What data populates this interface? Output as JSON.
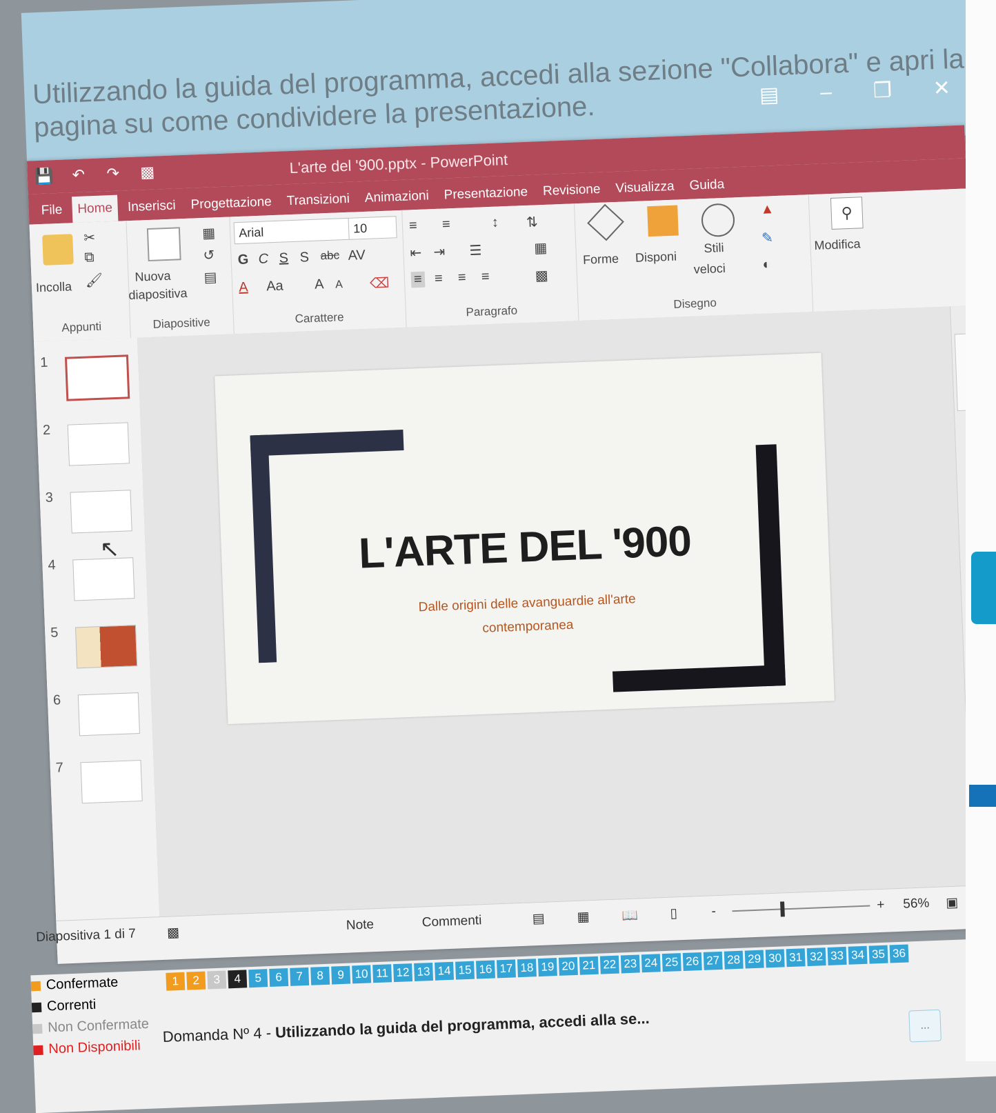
{
  "instruction": "Utilizzando la guida del programma, accedi alla sezione \"Collabora\" e apri la pagina su come condividere la presentazione.",
  "window": {
    "title": "L'arte del '900.pptx - PowerPoint",
    "tabs": [
      "File",
      "Home",
      "Inserisci",
      "Progettazione",
      "Transizioni",
      "Animazioni",
      "Presentazione",
      "Revisione",
      "Visualizza",
      "Guida"
    ],
    "active_tab": "Home"
  },
  "ribbon": {
    "clipboard": {
      "paste_label": "Incolla",
      "group_label": "Appunti"
    },
    "slides": {
      "new_slide_label_1": "Nuova",
      "new_slide_label_2": "diapositiva",
      "group_label": "Diapositive"
    },
    "font": {
      "font_name": "Arial",
      "font_size": "10",
      "bold": "G",
      "italic": "C",
      "underline": "S",
      "shadow": "S",
      "strike": "abc",
      "spacing": "AV",
      "color": "A",
      "case": "Aa",
      "grow": "A",
      "shrink": "A",
      "group_label": "Carattere"
    },
    "paragraph": {
      "group_label": "Paragrafo"
    },
    "drawing": {
      "shapes_label": "Forme",
      "arrange_label": "Disponi",
      "quick_styles_1": "Stili",
      "quick_styles_2": "veloci",
      "group_label": "Disegno"
    },
    "editing": {
      "label": "Modifica"
    }
  },
  "slides": [
    {
      "number": "1",
      "selected": true
    },
    {
      "number": "2"
    },
    {
      "number": "3"
    },
    {
      "number": "4"
    },
    {
      "number": "5"
    },
    {
      "number": "6"
    },
    {
      "number": "7"
    }
  ],
  "slide": {
    "title": "L'ARTE DEL '900",
    "subtitle": "Dalle origini delle avanguardie all'arte contemporanea"
  },
  "status": {
    "slide_counter": "Diapositiva 1 di 7",
    "notes": "Note",
    "comments": "Commenti",
    "zoom": "56%",
    "zoom_minus": "-",
    "zoom_plus": "+"
  },
  "footer": {
    "legend": [
      {
        "label": "Confermate",
        "color": "#f29c1f"
      },
      {
        "label": "Correnti",
        "color": "#222222"
      },
      {
        "label": "Non Confermate",
        "color": "#c8c8c8"
      },
      {
        "label": "Non Disponibili",
        "color": "#e02020"
      }
    ],
    "questions": [
      "1",
      "2",
      "3",
      "4",
      "5",
      "6",
      "7",
      "8",
      "9",
      "10",
      "11",
      "12",
      "13",
      "14",
      "15",
      "16",
      "17",
      "18",
      "19",
      "20",
      "21",
      "22",
      "23",
      "24",
      "25",
      "26",
      "27",
      "28",
      "29",
      "30",
      "31",
      "32",
      "33",
      "34",
      "35",
      "36"
    ],
    "question_prefix": "Domanda Nº 4 -",
    "question_text": "Utilizzando la guida del programma, accedi alla se...",
    "more": "..."
  }
}
